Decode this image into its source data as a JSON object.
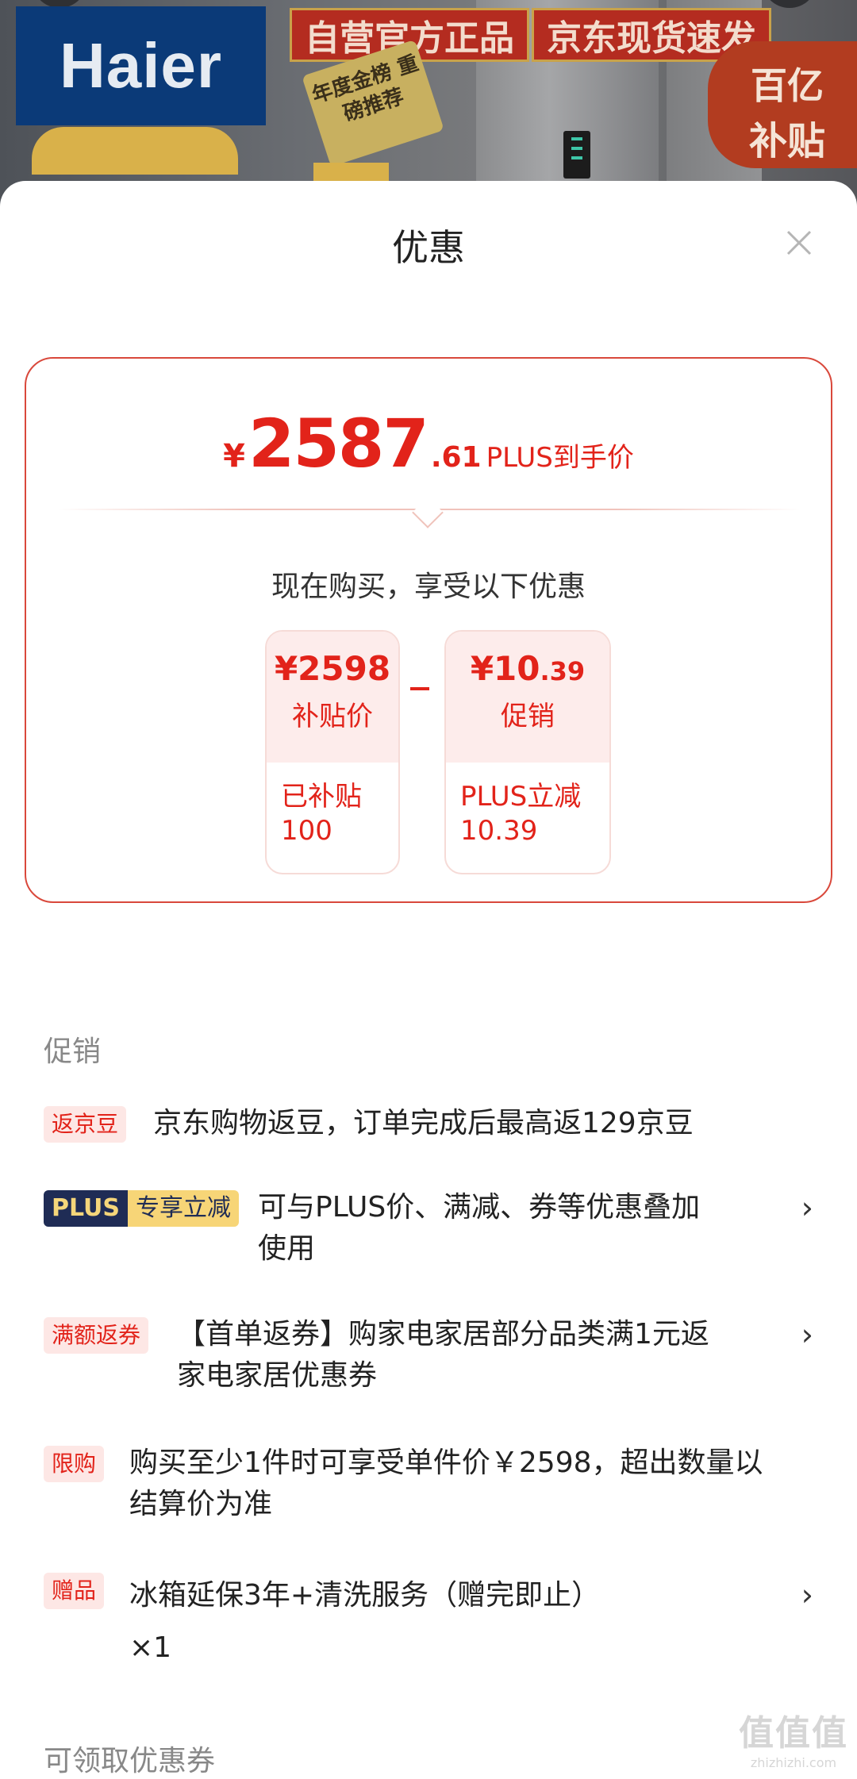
{
  "hero": {
    "brand_logo": "Haier",
    "tag_genuine": "自营官方正品",
    "tag_fast": "京东现货速发",
    "badge_text": "年度金榜 重磅推荐",
    "subsidy_line1": "百亿",
    "subsidy_line2": "补贴"
  },
  "sheet": {
    "title": "优惠",
    "close_icon": "close-icon"
  },
  "price_card": {
    "currency": "¥",
    "price_int": "2587",
    "price_dec": ".61",
    "price_label": "PLUS到手价",
    "enjoy_text": "现在购买，享受以下优惠",
    "boxes": [
      {
        "value": "¥2598",
        "caption": "补贴价",
        "detail_line1": "已补贴",
        "detail_line2": "100"
      },
      {
        "value_main": "¥10",
        "value_dec": ".39",
        "caption": "促销",
        "detail_line1": "PLUS立减",
        "detail_line2": "10.39"
      }
    ]
  },
  "promotions": {
    "section_title": "促销",
    "items": [
      {
        "badge": "返京豆",
        "text": "京东购物返豆，订单完成后最高返129京豆",
        "has_arrow": false
      },
      {
        "badge_plus": "PLUS",
        "badge_tail": "专享立减",
        "text_line1": "可与PLUS价、满减、券等优惠叠加",
        "text_line2": "使用",
        "has_arrow": true
      },
      {
        "badge": "满额返券",
        "text_line1": "【首单返券】购家电家居部分品类满1元返",
        "text_line2": "家电家居优惠券",
        "has_arrow": true
      },
      {
        "badge": "限购",
        "text_line1": "购买至少1件时可享受单件价￥2598，超出数量以",
        "text_line2": "结算价为准",
        "has_arrow": false
      },
      {
        "badge": "赠品",
        "text_line1": "冰箱延保3年+清洗服务（赠完即止）",
        "text_line2": "×1",
        "has_arrow": true
      }
    ],
    "arrow": "›"
  },
  "coupons": {
    "section_title": "可领取优惠券"
  },
  "watermark": {
    "line1": "值值值",
    "line2": "zhizhizhi.com"
  },
  "colors": {
    "accent_red": "#e2231a",
    "plus_navy": "#1f2c55",
    "plus_gold": "#f7d577"
  }
}
